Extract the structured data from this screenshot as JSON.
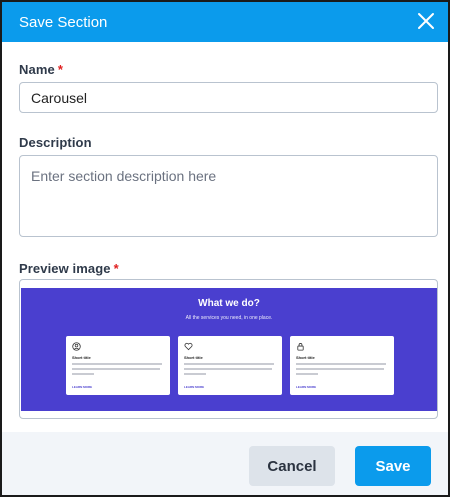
{
  "dialog": {
    "title": "Save Section",
    "close_icon": "close-icon",
    "accent_color": "#0b9bec"
  },
  "form": {
    "name_label": "Name",
    "required_marker": "*",
    "name_value": "Carousel",
    "description_label": "Description",
    "description_placeholder": "Enter section description here",
    "description_value": "",
    "preview_label": "Preview image"
  },
  "preview": {
    "heading": "What we do?",
    "subheading": "All the services you need, in one place.",
    "cards": [
      {
        "icon": "user-circle-icon",
        "title": "Short title",
        "link": "LEARN MORE"
      },
      {
        "icon": "heart-icon",
        "title": "Short title",
        "link": "LEARN MORE"
      },
      {
        "icon": "lock-icon",
        "title": "Short title",
        "link": "LEARN MORE"
      }
    ],
    "banner_color": "#4a3fcf"
  },
  "footer": {
    "cancel_label": "Cancel",
    "save_label": "Save"
  }
}
